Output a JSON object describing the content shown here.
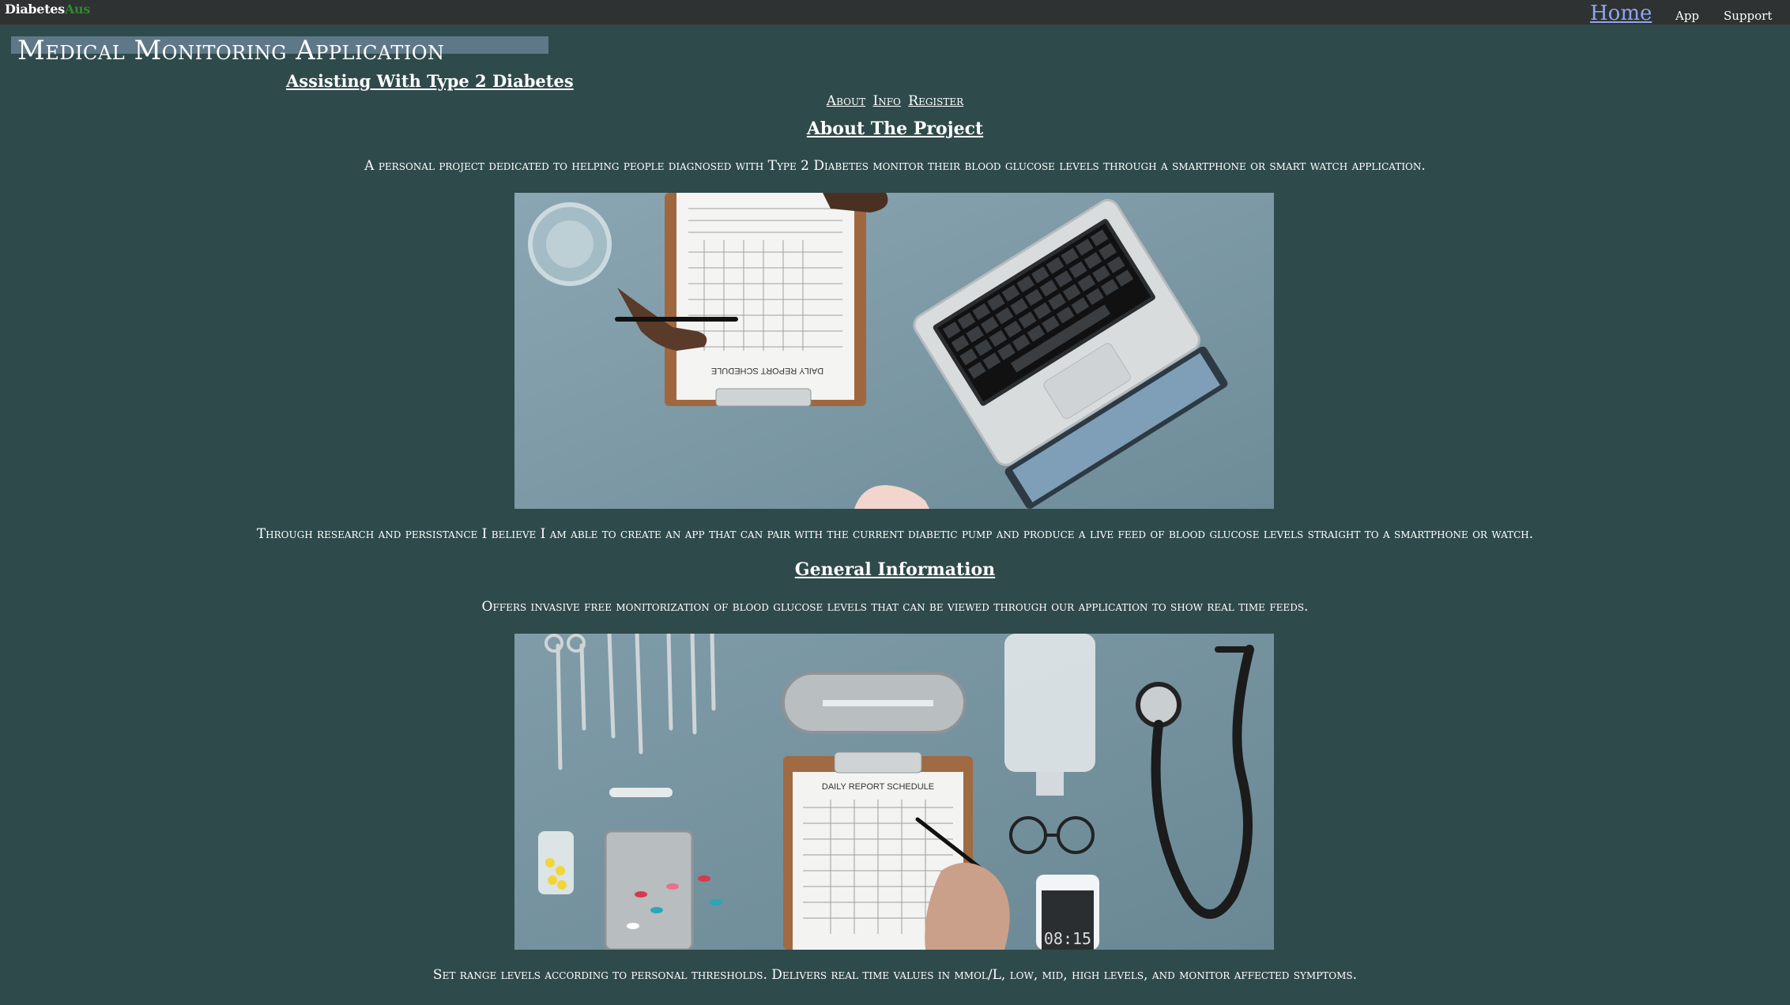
{
  "topbar": {
    "brand_part1": "Diabetes",
    "brand_part2": "Aus",
    "nav_home": "Home",
    "nav_app": "App",
    "nav_support": "Support"
  },
  "header": {
    "title": "Medical Monitoring Application",
    "subtitle": "Assisting With Type 2 Diabetes"
  },
  "section_nav": {
    "about": "About",
    "info": "Info",
    "register": "Register"
  },
  "about": {
    "heading": "About The Project",
    "intro": "A personal project dedicated to helping people diagnosed with Type 2 Diabetes monitor their blood glucose levels through a smartphone or smart watch application.",
    "image_alt": "Doctor's desk with clipboard daily report schedule, laptop and glass of water",
    "image_text": "DAILY REPORT SCHEDULE",
    "body": "Through research and persistance I believe I am able to create an app that can pair with the current diabetic pump and produce a live feed of blood glucose levels straight to a smartphone or watch."
  },
  "general": {
    "heading": "General Information",
    "intro": "Offers invasive free monitorization of blood glucose levels that can be viewed through our application to show real time feeds.",
    "image_alt": "Medical instruments, stethoscope, pills, syringe, clipboard and smartphone",
    "image_text": "DAILY REPORT SCHEDULE",
    "phone_time": "08:15",
    "body": "Set range levels according to personal thresholds. Delivers real time values in mmol/L, low, mid, high levels, and monitor affected symptoms."
  },
  "colors": {
    "background": "#2f4a4b",
    "topbar": "#2e3233",
    "home_link": "#8fa6ee",
    "brand_accent": "#2f8a2a",
    "title_highlight": "#5e7888"
  }
}
